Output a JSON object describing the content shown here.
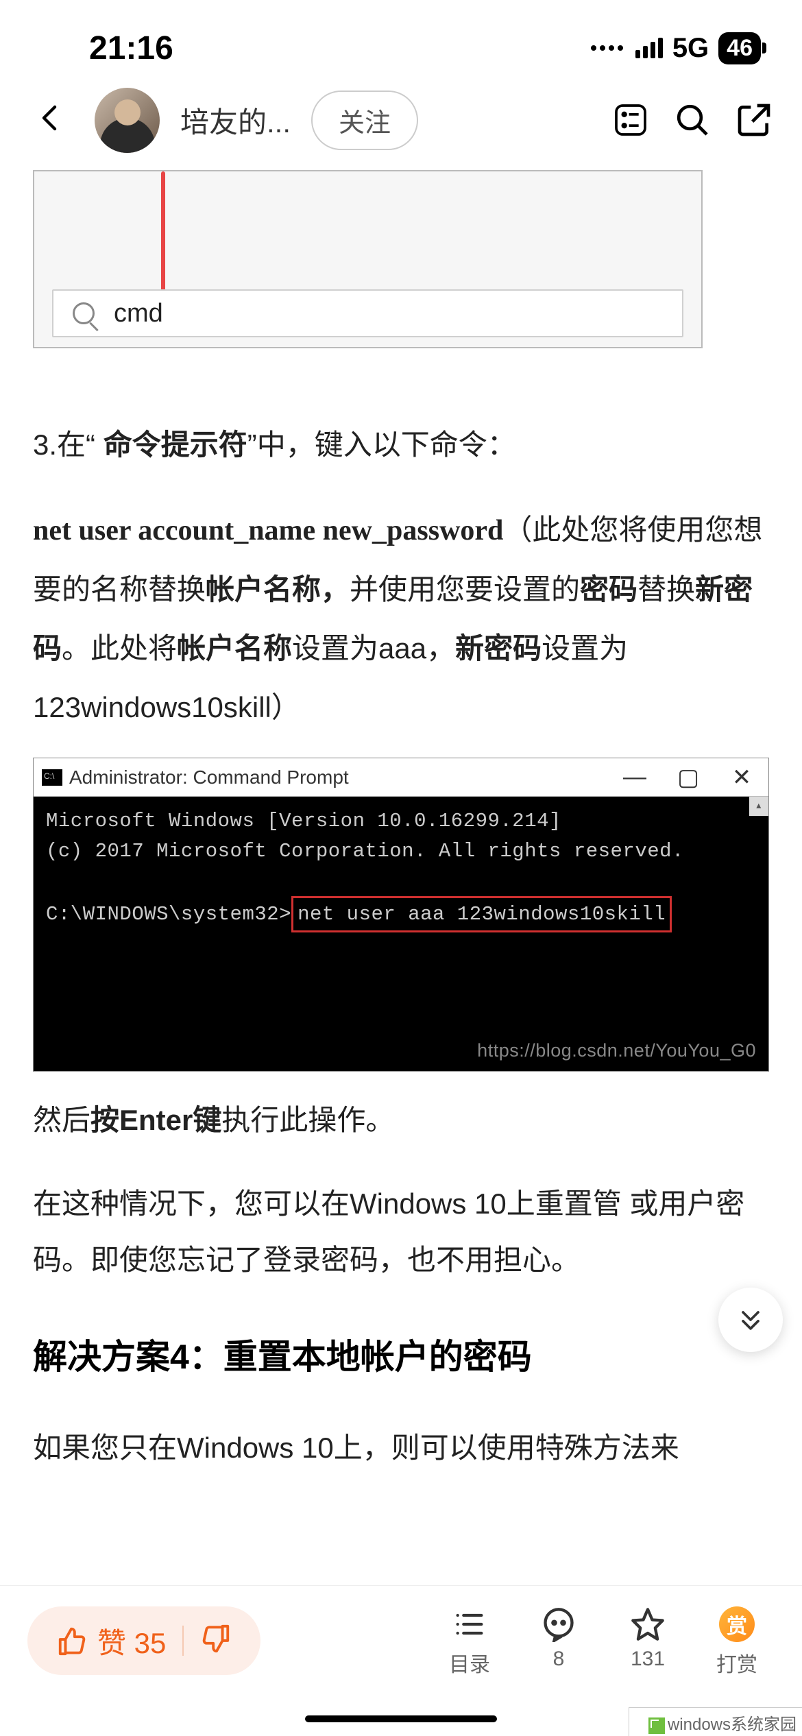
{
  "status": {
    "time": "21:16",
    "network": "5G",
    "battery": "46"
  },
  "header": {
    "author_truncated": "培友的...",
    "follow_label": "关注"
  },
  "content": {
    "cmd_search_text": "cmd",
    "step3_prefix": "3.在“ ",
    "step3_bold": "命令提示符",
    "step3_mid": "”中，键入以下命令：",
    "cmd_syntax": "net user account_name new_password",
    "p2_a": "（此处您将使用您想要的名称替换",
    "p2_b": "帐户名称，",
    "p2_c": "并使用您要设置的",
    "p2_d": "密码",
    "p2_e": "替换",
    "p2_f": "新密码",
    "p2_g": "。此处将",
    "p2_h": "帐户名称",
    "p2_i": "设置为aaa，",
    "p2_j": "新密码",
    "p2_k": "设置为123windows10skill）",
    "cmdw_title": "Administrator: Command Prompt",
    "cmdw_line1": "Microsoft Windows [Version 10.0.16299.214]",
    "cmdw_line2": "(c) 2017 Microsoft Corporation. All rights reserved.",
    "cmdw_prompt": "C:\\WINDOWS\\system32>",
    "cmdw_cmd": "net user aaa  123windows10skill",
    "cmdw_watermark": "https://blog.csdn.net/YouYou_G0",
    "p3_a": "然后",
    "p3_b": "按Enter键",
    "p3_c": "执行此操作。",
    "p4": "在这种情况下，您可以在Windows 10上重置管       或用户密码。即使您忘记了登录密码，也不用担心。",
    "h2": "解决方案4：重置本地帐户的密码",
    "cutoff": "如果您只在Windows 10上，则可以使用特殊方法来"
  },
  "bottom": {
    "like_label": "赞 35",
    "toc_label": "目录",
    "comment_count": "8",
    "fav_count": "131",
    "reward_label": "打赏",
    "reward_char": "赏"
  },
  "footer_logo": "windows系统家园"
}
